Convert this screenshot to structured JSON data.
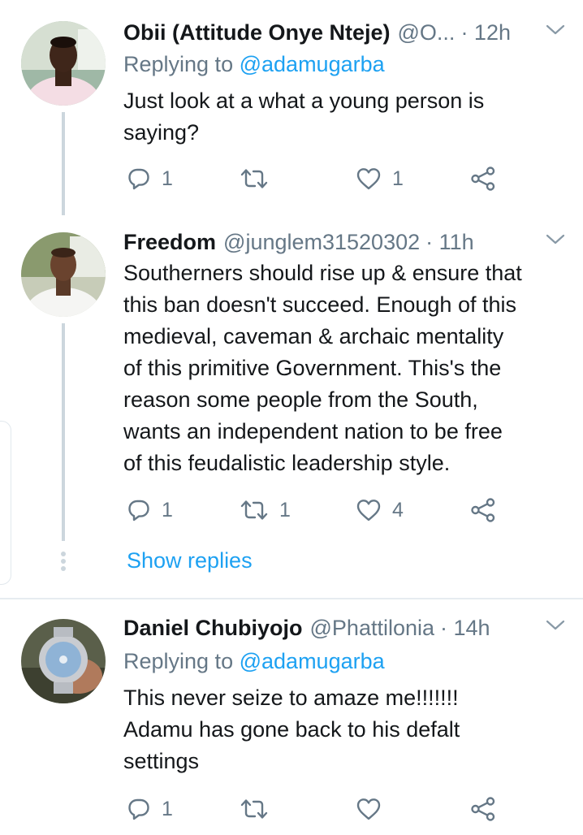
{
  "tweets": [
    {
      "name": "Obii (Attitude Onye Nteje)",
      "handle": "@O...",
      "time": "· 12h",
      "replying_prefix": "Replying to",
      "replying_to": "@adamugarba",
      "lines": [
        "Just look at a what a young person is",
        "saying?"
      ],
      "reply_count": "1",
      "retweet_count": "",
      "like_count": "1"
    },
    {
      "name": "Freedom",
      "handle": "@junglem31520302",
      "time": "· 11h",
      "lines": [
        "Southerners should rise up & ensure that",
        "this ban doesn't succeed. Enough of this",
        "medieval, caveman & archaic mentality",
        "of this primitive Government. This's the",
        "reason some people from the South,",
        "wants an independent nation to be free",
        "of this feudalistic leadership style."
      ],
      "reply_count": "1",
      "retweet_count": "1",
      "like_count": "4",
      "show_replies": "Show replies"
    },
    {
      "name": "Daniel Chubiyojo",
      "handle": "@Phattilonia",
      "time": "· 14h",
      "replying_prefix": "Replying to",
      "replying_to": "@adamugarba",
      "lines": [
        "This never seize to amaze me!!!!!!!",
        "Adamu has gone back to his defalt",
        "settings"
      ],
      "reply_count": "1",
      "retweet_count": "",
      "like_count": ""
    }
  ],
  "icons": {
    "reply": "reply-icon",
    "retweet": "retweet-icon",
    "like": "heart-icon",
    "share": "share-icon",
    "more": "chevron-down-icon"
  },
  "colors": {
    "text": "#14171a",
    "secondary": "#657786",
    "accent": "#1da1f2",
    "thread_line": "#ccd6dd"
  }
}
